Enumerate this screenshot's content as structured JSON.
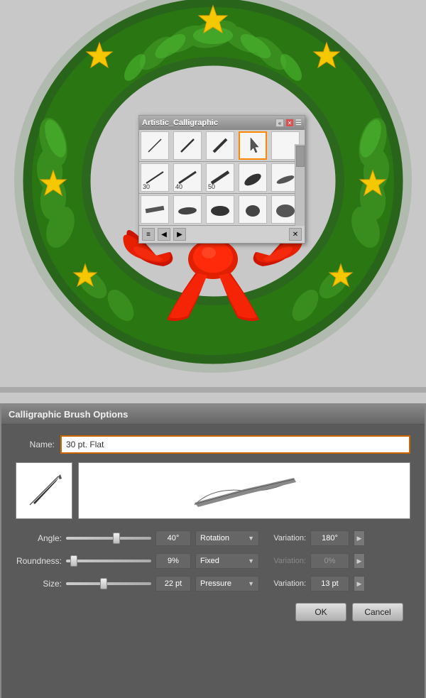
{
  "wreath": {
    "alt": "Christmas wreath with bow"
  },
  "brushPanel": {
    "title": "Artistic_Calligraphic",
    "brushes": [
      {
        "label": "",
        "type": "thin-diagonal"
      },
      {
        "label": "",
        "type": "medium-diagonal"
      },
      {
        "label": "",
        "type": "thick-diagonal"
      },
      {
        "label": "",
        "type": "selected-callig"
      },
      {
        "label": "",
        "type": "empty"
      },
      {
        "label": "30",
        "type": "brush30"
      },
      {
        "label": "40",
        "type": "brush40"
      },
      {
        "label": "50",
        "type": "brush50"
      },
      {
        "label": "",
        "type": "oval1"
      },
      {
        "label": "",
        "type": "oval2"
      },
      {
        "label": "",
        "type": "flat-row2-1"
      },
      {
        "label": "",
        "type": "flat-row2-2"
      },
      {
        "label": "",
        "type": "flat-row2-3"
      },
      {
        "label": "",
        "type": "flat-row2-4"
      },
      {
        "label": "",
        "type": "flat-row2-5"
      }
    ]
  },
  "dialog": {
    "title": "Calligraphic Brush Options",
    "nameLabel": "Name:",
    "nameValue": "30 pt. Flat",
    "angle": {
      "label": "Angle:",
      "value": "40°",
      "mode": "Rotation",
      "variationLabel": "Variation:",
      "variationValue": "180°"
    },
    "roundness": {
      "label": "Roundness:",
      "value": "9%",
      "mode": "Fixed",
      "variationLabel": "Variation:",
      "variationValue": "0%"
    },
    "size": {
      "label": "Size:",
      "value": "22 pt",
      "mode": "Pressure",
      "variationLabel": "Variation:",
      "variationValue": "13 pt"
    },
    "okLabel": "OK",
    "cancelLabel": "Cancel"
  }
}
